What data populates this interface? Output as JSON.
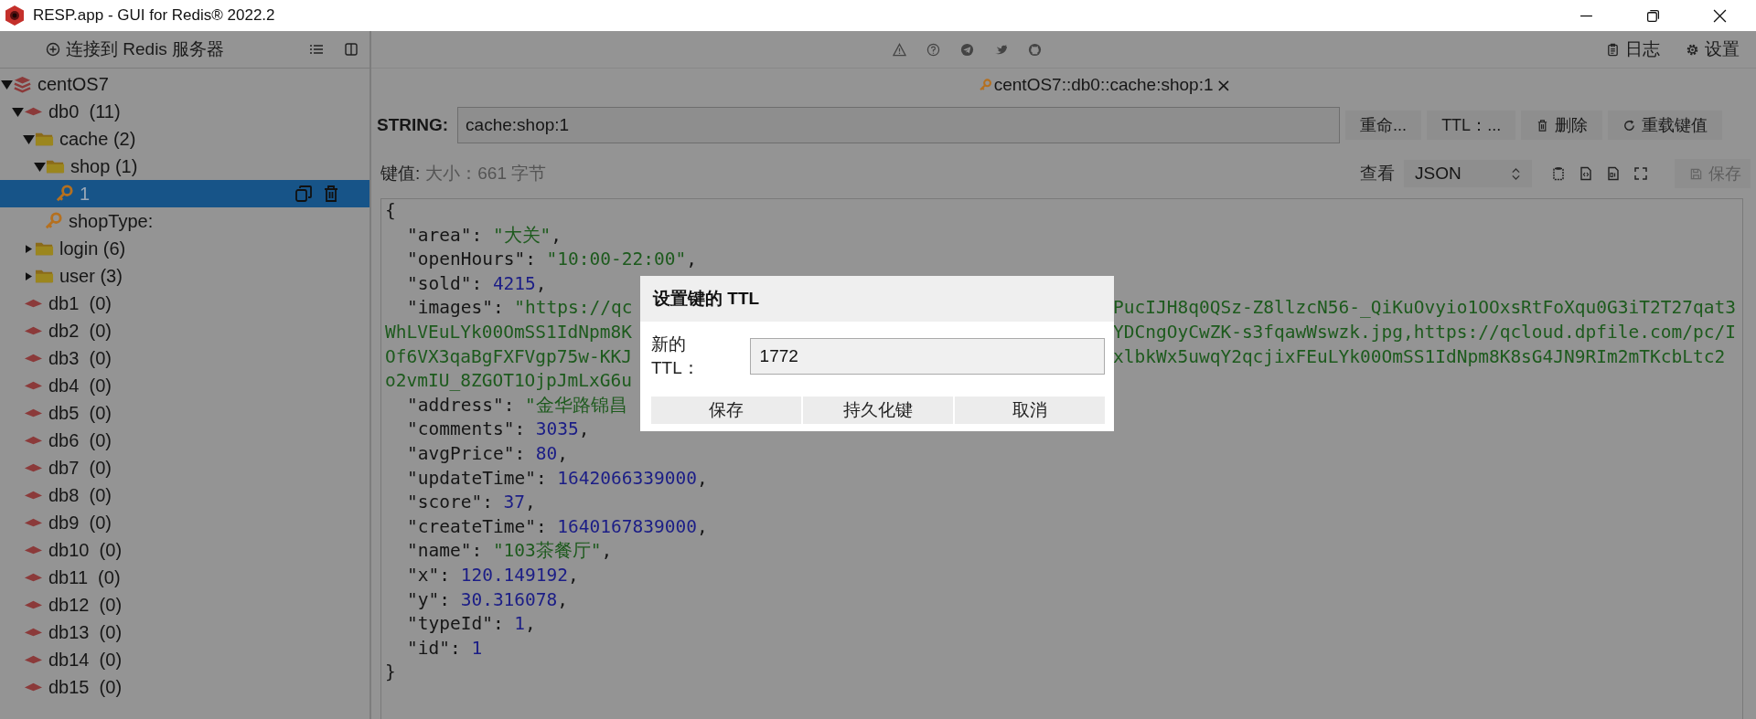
{
  "window": {
    "title": "RESP.app - GUI for Redis® 2022.2"
  },
  "sidebar": {
    "connect_label": "连接到 Redis 服务器",
    "tree": [
      {
        "label": "centOS7",
        "kind": "server",
        "expanded": true,
        "selected": false,
        "children": [
          {
            "label": "db0  (11)",
            "kind": "db",
            "expanded": true,
            "selected": false,
            "children": [
              {
                "label": "cache (2)",
                "kind": "folder",
                "expanded": true,
                "selected": false,
                "children": [
                  {
                    "label": "shop (1)",
                    "kind": "folder",
                    "expanded": true,
                    "selected": false,
                    "children": [
                      {
                        "label": "1",
                        "kind": "key",
                        "selected": true
                      }
                    ]
                  },
                  {
                    "label": "shopType:",
                    "kind": "key",
                    "selected": false
                  }
                ]
              },
              {
                "label": "login (6)",
                "kind": "folder",
                "expanded": false,
                "selected": false
              },
              {
                "label": "user (3)",
                "kind": "folder",
                "expanded": false,
                "selected": false
              }
            ]
          },
          {
            "label": "db1  (0)",
            "kind": "db",
            "selected": false
          },
          {
            "label": "db2  (0)",
            "kind": "db",
            "selected": false
          },
          {
            "label": "db3  (0)",
            "kind": "db",
            "selected": false
          },
          {
            "label": "db4  (0)",
            "kind": "db",
            "selected": false
          },
          {
            "label": "db5  (0)",
            "kind": "db",
            "selected": false
          },
          {
            "label": "db6  (0)",
            "kind": "db",
            "selected": false
          },
          {
            "label": "db7  (0)",
            "kind": "db",
            "selected": false
          },
          {
            "label": "db8  (0)",
            "kind": "db",
            "selected": false
          },
          {
            "label": "db9  (0)",
            "kind": "db",
            "selected": false
          },
          {
            "label": "db10  (0)",
            "kind": "db",
            "selected": false
          },
          {
            "label": "db11  (0)",
            "kind": "db",
            "selected": false
          },
          {
            "label": "db12  (0)",
            "kind": "db",
            "selected": false
          },
          {
            "label": "db13  (0)",
            "kind": "db",
            "selected": false
          },
          {
            "label": "db14  (0)",
            "kind": "db",
            "selected": false
          },
          {
            "label": "db15  (0)",
            "kind": "db",
            "selected": false
          }
        ]
      }
    ]
  },
  "toolbar": {
    "log_label": "日志",
    "settings_label": "设置"
  },
  "tab": {
    "label": "centOS7::db0::cache:shop:1",
    "close": "×"
  },
  "key_bar": {
    "type_label": "STRING:",
    "key_name": "cache:shop:1",
    "buttons": [
      {
        "label": "重命...",
        "kind": "plain"
      },
      {
        "label": "TTL：...",
        "kind": "plain"
      },
      {
        "label": "删除",
        "kind": "delete"
      },
      {
        "label": "重载键值",
        "kind": "reload"
      }
    ]
  },
  "value_bar": {
    "label": "键值:",
    "size": "大小：661 字节",
    "view_label": "查看",
    "format": "JSON",
    "save": {
      "label": "保存",
      "disabled": true
    }
  },
  "code_lines": [
    {
      "kind": "brace",
      "text": "{"
    },
    {
      "kind": "entry",
      "key": "\"area\":",
      "string": "\"大关\"",
      "tail": ","
    },
    {
      "kind": "entry",
      "key": "\"openHours\":",
      "string": "\"10:00-22:00\"",
      "tail": ","
    },
    {
      "kind": "entry",
      "key": "\"sold\":",
      "number": "4215",
      "tail": ","
    },
    {
      "kind": "entry",
      "key": "\"images\":",
      "string": "\"https://qc",
      "right": "PucIJH8q0QSz-Z8llzcN56-_QiKuOvyio1OOxsRtFoXqu0G3iT2T27qat3"
    },
    {
      "kind": "wrap",
      "text": "WhLVEuLYk00OmSS1IdNpm8K",
      "right": "YDCngOyCwZK-s3fqawWswzk.jpg,https://qcloud.dpfile.com/pc/I"
    },
    {
      "kind": "wrap",
      "text": "Of6VX3qaBgFXFVgp75w-KKJ",
      "right": "xlbkWx5uwqY2qcjixFEuLYk00OmSS1IdNpm8K8sG4JN9RIm2mTKcbLtc2"
    },
    {
      "kind": "wrap",
      "text": "o2vmIU_8ZGOT1OjpJmLxG6u"
    },
    {
      "kind": "entry",
      "key": "\"address\":",
      "string": "\"金华路锦昌"
    },
    {
      "kind": "entry",
      "key": "\"comments\":",
      "number": "3035",
      "tail": ","
    },
    {
      "kind": "entry",
      "key": "\"avgPrice\":",
      "number": "80",
      "tail": ","
    },
    {
      "kind": "entry",
      "key": "\"updateTime\":",
      "number": "1642066339000",
      "tail": ","
    },
    {
      "kind": "entry",
      "key": "\"score\":",
      "number": "37",
      "tail": ","
    },
    {
      "kind": "entry",
      "key": "\"createTime\":",
      "number": "1640167839000",
      "tail": ","
    },
    {
      "kind": "entry",
      "key": "\"name\":",
      "string": "\"103茶餐厅\"",
      "tail": ","
    },
    {
      "kind": "entry",
      "key": "\"x\":",
      "number": "120.149192",
      "tail": ","
    },
    {
      "kind": "entry",
      "key": "\"y\":",
      "number": "30.316078",
      "tail": ","
    },
    {
      "kind": "entry",
      "key": "\"typeId\":",
      "number": "1",
      "tail": ","
    },
    {
      "kind": "entry",
      "key": "\"id\":",
      "number": "1"
    },
    {
      "kind": "brace",
      "text": "}"
    }
  ],
  "dialog": {
    "title": "设置键的 TTL",
    "field_label": "新的 TTL：",
    "ttl_value": "1772",
    "buttons": [
      "保存",
      "持久化键",
      "取消"
    ]
  }
}
